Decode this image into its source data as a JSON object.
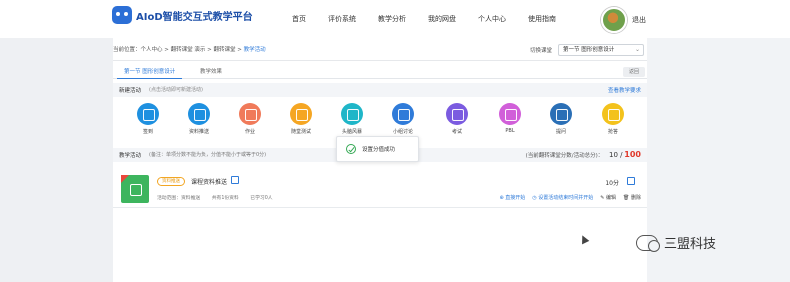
{
  "brand": {
    "title": "AIoD智能交互式教学平台"
  },
  "nav": [
    {
      "label": "首页"
    },
    {
      "label": "评价系统"
    },
    {
      "label": "教学分析"
    },
    {
      "label": "我的网盘"
    },
    {
      "label": "个人中心"
    },
    {
      "label": "使用指南"
    }
  ],
  "user": {
    "logout": "退出"
  },
  "breadcrumb": {
    "prefix": "当前位置：",
    "path": "个人中心 > 翻转课堂 演示 > 翻转课堂 > ",
    "current": "教学活动"
  },
  "course_switch": {
    "label": "切换课堂",
    "selected": "第一节 图形创意设计"
  },
  "tabs": [
    {
      "label": "第一节 图形创意设计"
    },
    {
      "label": "教学效果"
    }
  ],
  "tab_button": "返回",
  "new_activity": {
    "title": "新建活动",
    "tip": "(点击活动即可新建活动)",
    "link": "查看教学要求"
  },
  "activities": [
    {
      "label": "签到",
      "color": "#1e90e0"
    },
    {
      "label": "资料推送",
      "color": "#1e90e0"
    },
    {
      "label": "作业",
      "color": "#f07a5a"
    },
    {
      "label": "随堂测试",
      "color": "#f5a623"
    },
    {
      "label": "头脑风暴",
      "color": "#1fb6c8"
    },
    {
      "label": "小组讨论",
      "color": "#2f7bd9"
    },
    {
      "label": "考试",
      "color": "#7b5be0"
    },
    {
      "label": "PBL",
      "color": "#d15fd9"
    },
    {
      "label": "提问",
      "color": "#2a6fb6"
    },
    {
      "label": "抢答",
      "color": "#f3c21c"
    }
  ],
  "toast": {
    "text": "设置分值成功"
  },
  "teaching": {
    "title": "教学活动",
    "note": "(备注：单项分数不能为负，分值不能小于或等于0分)",
    "score_label": "(当前翻转课堂分数/活动总分)：",
    "score_current": "10 /",
    "score_max": "100"
  },
  "activity_item": {
    "badge": "资料推送",
    "name": "课程资料推送",
    "meta": [
      "活动范围：资料推送",
      "共有1份资料",
      "已学习0人"
    ],
    "score": "10分",
    "ops": [
      "直接开始",
      "设置活动结束时间并开始",
      "编辑",
      "删除"
    ]
  },
  "watermark": {
    "text": "三盟科技"
  }
}
